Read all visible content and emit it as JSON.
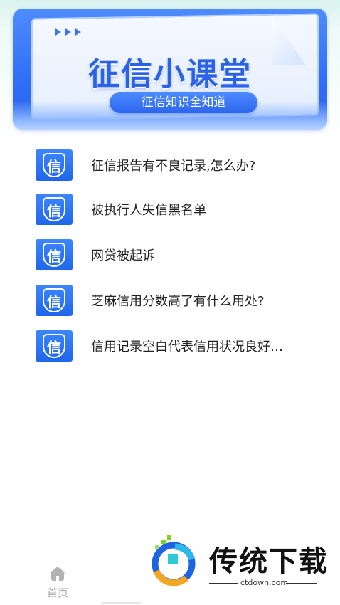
{
  "banner": {
    "title": "征信小课堂",
    "subtitle": "征信知识全知道"
  },
  "list": {
    "badge_char": "信",
    "items": [
      {
        "label": "征信报告有不良记录,怎么办?"
      },
      {
        "label": "被执行人失信黑名单"
      },
      {
        "label": "网贷被起诉"
      },
      {
        "label": "芝麻信用分数高了有什么用处?"
      },
      {
        "label": "信用记录空白代表信用状况良好…"
      }
    ]
  },
  "tabbar": {
    "home_label": "首页"
  },
  "watermark": {
    "text": "传统下载",
    "domain": "ctdown.com"
  },
  "colors": {
    "accent": "#2f6ff5",
    "badge": "#1f66ea"
  },
  "icons": {
    "badge": "credit-shield-icon",
    "home": "home-icon"
  }
}
